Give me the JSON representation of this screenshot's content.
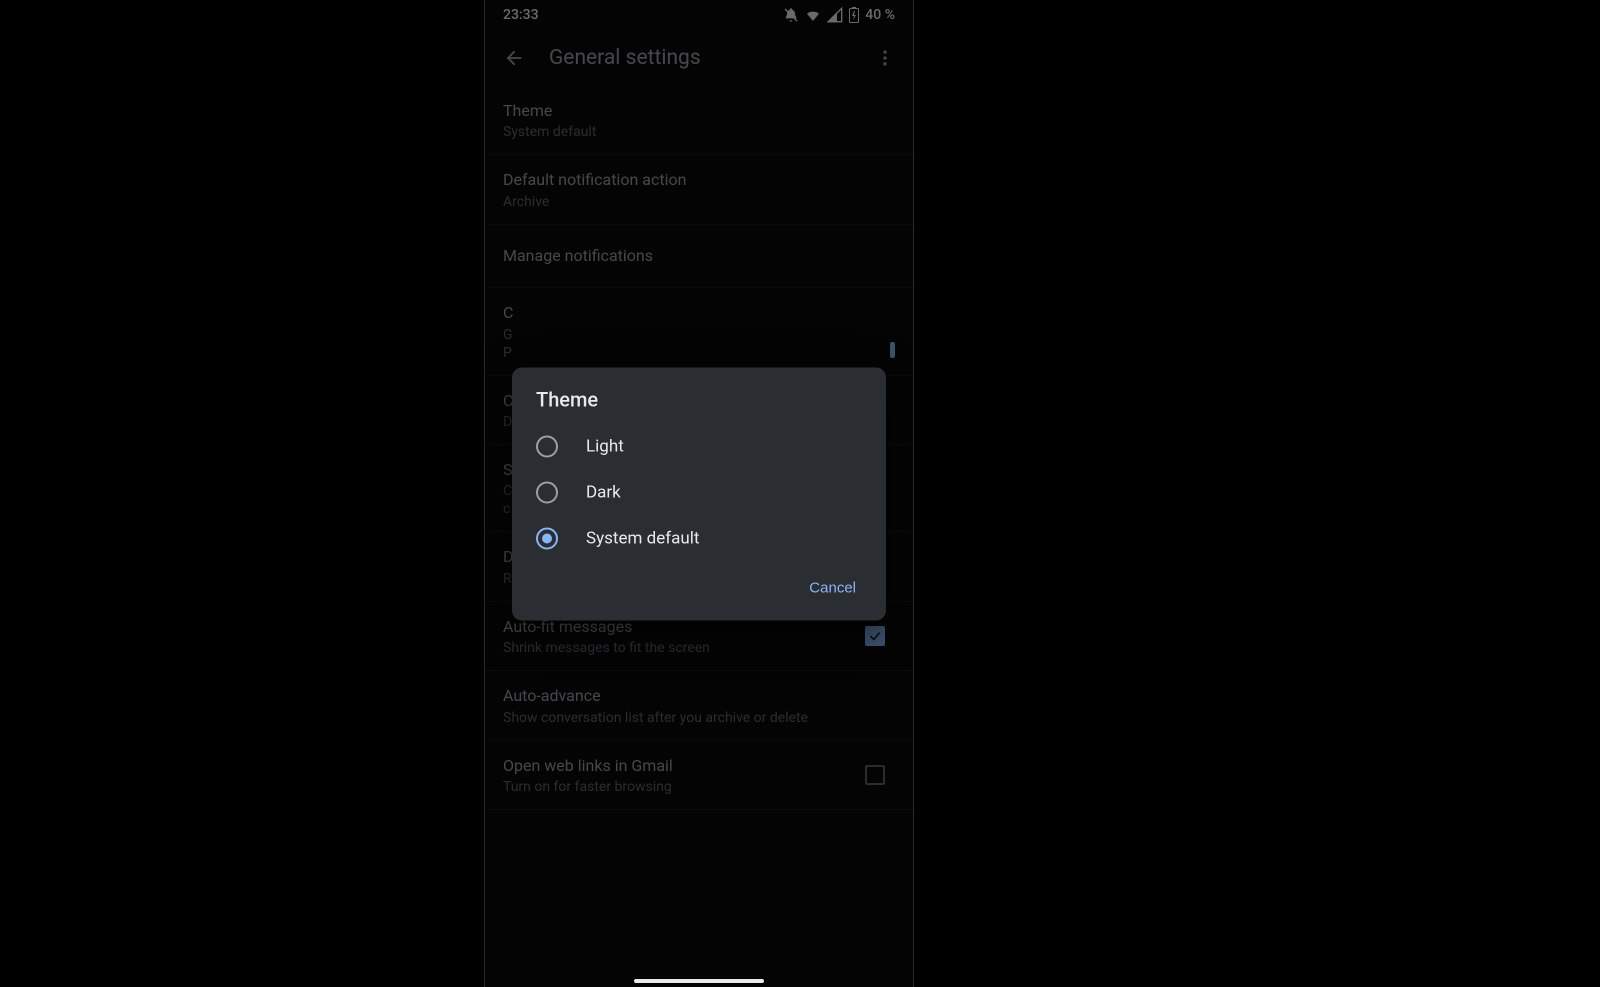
{
  "status": {
    "time": "23:33",
    "battery_text": "40 %"
  },
  "appbar": {
    "title": "General settings"
  },
  "settings": {
    "theme": {
      "title": "Theme",
      "value": "System default"
    },
    "notif_action": {
      "title": "Default notification action",
      "value": "Archive"
    },
    "manage_notif": {
      "title": "Manage notifications"
    },
    "conv_view": {
      "title": "C",
      "value": "G"
    },
    "conv_density": {
      "title": "C",
      "value": "D"
    },
    "swipe": {
      "title": "S",
      "sub1": "C",
      "sub2": "c"
    },
    "reply_action": {
      "title": "Default reply action",
      "value": "Reply"
    },
    "autofit": {
      "title": "Auto-fit messages",
      "value": "Shrink messages to fit the screen",
      "checked": true
    },
    "autoadvance": {
      "title": "Auto-advance",
      "value": "Show conversation list after you archive or delete"
    },
    "weblinks": {
      "title": "Open web links in Gmail",
      "value": "Turn on for faster browsing",
      "checked": false
    }
  },
  "dialog": {
    "title": "Theme",
    "options": {
      "light": "Light",
      "dark": "Dark",
      "system": "System default"
    },
    "selected": "system",
    "cancel": "Cancel"
  }
}
